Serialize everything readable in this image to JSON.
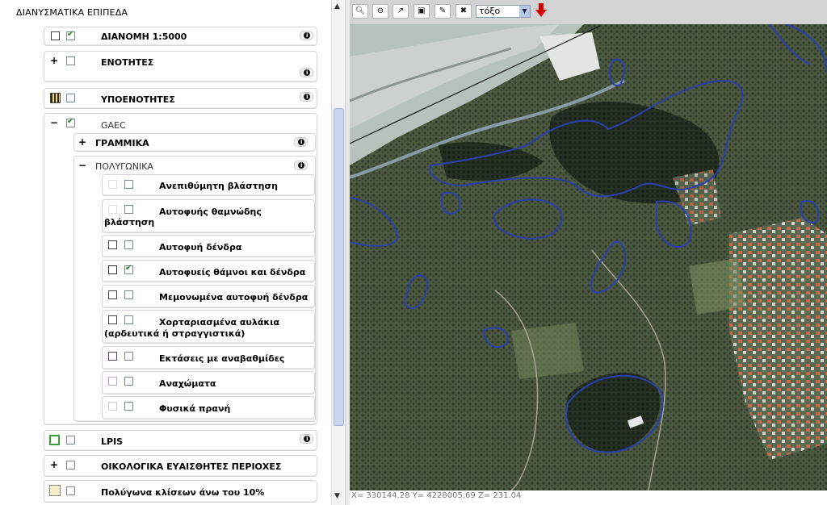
{
  "panel": {
    "title": "ΔΙΑΝΥΣΜΑΤΙΚΑ ΕΠΙΠΕΔΑ"
  },
  "layers": {
    "dianomi": {
      "label": "ΔΙΑΝΟΜΗ 1:5000",
      "checked": true
    },
    "enotites": {
      "label": "ΕΝΟΤΗΤΕΣ",
      "checked": false
    },
    "ypoenotites": {
      "label": "ΥΠΟΕΝΟΤΗΤΕΣ",
      "checked": false
    },
    "gaec": {
      "label": "GAEC",
      "checked": true
    },
    "grammika": {
      "label": "ΓΡΑΜΜΙΚΑ"
    },
    "polygonika": {
      "label": "ΠΟΛΥΓΩΝΙΚΑ"
    },
    "lpis": {
      "label": "LPIS",
      "checked": false
    },
    "oikologika": {
      "label": "ΟΙΚΟΛΟΓΙΚΑ ΕΥΑΙΣΘΗΤΕΣ ΠΕΡΙΟΧΕΣ",
      "checked": false
    },
    "klisi": {
      "label": "Πολύγωνα κλίσεων άνω του 10%",
      "checked": false
    }
  },
  "polygon_layers": [
    {
      "label": "Ανεπιθύμητη βλάστηση",
      "checked": false
    },
    {
      "label_line1": "Αυτοφυής θαμνώδης",
      "label_line2": "βλάστηση",
      "checked": false
    },
    {
      "label": "Αυτοφυή δένδρα",
      "checked": false
    },
    {
      "label": "Αυτοφυείς θάμνοι και δένδρα",
      "checked": true
    },
    {
      "label": "Μεμονωμένα αυτοφυή δένδρα",
      "checked": false
    },
    {
      "label_line1": "Χορταριασμένα αυλάκια",
      "label_line2": "(αρδευτικά ή στραγγιστικά)",
      "checked": false
    },
    {
      "label": "Εκτάσεις με αναβαθμίδες",
      "checked": false
    },
    {
      "label": "Αναχώματα",
      "checked": false
    },
    {
      "label": "Φυσικά πρανή",
      "checked": false
    }
  ],
  "expanders": {
    "plus": "+",
    "minus": "−"
  },
  "info_glyph": "i",
  "toolbar": {
    "select_value": "τόξο",
    "select_arrow": "▼"
  },
  "status": {
    "coords": "X= 330144.28 Y= 4228005.69 Z= 231.04"
  },
  "colors": {
    "outline_blue": "#2a3fb0",
    "check_green": "#2a7a2a",
    "accent_red": "#d40000"
  }
}
